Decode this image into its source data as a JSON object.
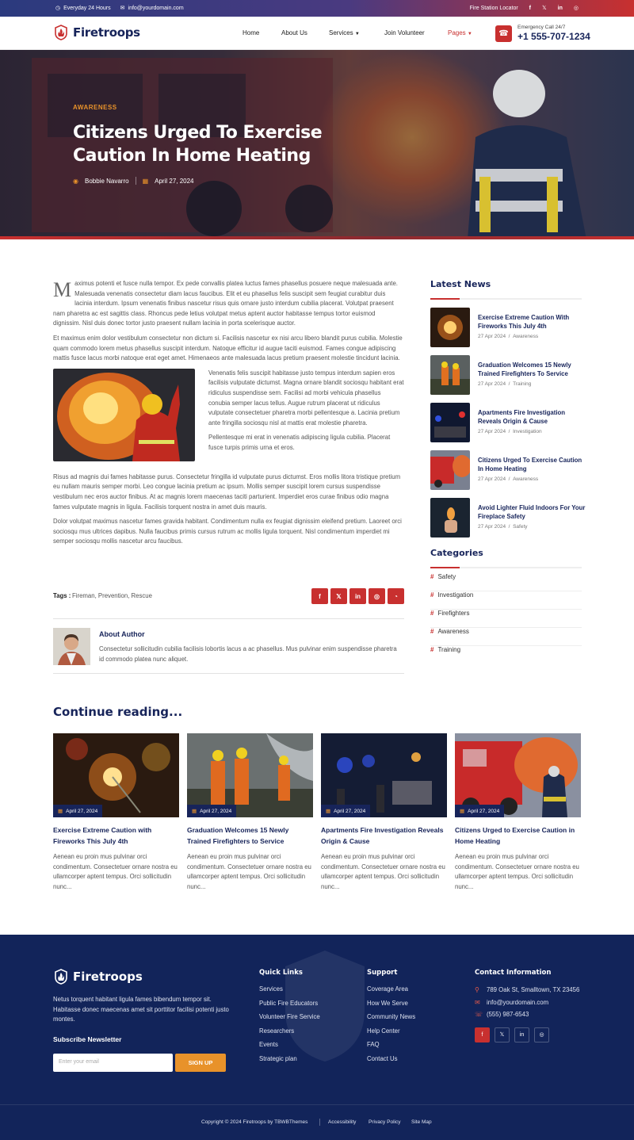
{
  "topbar": {
    "hours": "Everyday 24 Hours",
    "email": "info@yourdomain.com",
    "locator": "Fire Station Locator"
  },
  "brand": {
    "name": "Firetroops"
  },
  "nav": {
    "home": "Home",
    "about": "About Us",
    "services": "Services",
    "join": "Join Volunteer",
    "pages": "Pages"
  },
  "emergency": {
    "label": "Emergency Call 24/7",
    "phone": "+1 555-707-1234"
  },
  "hero": {
    "category": "AWARENESS",
    "title": "Citizens Urged To Exercise Caution In Home Heating",
    "author": "Bobbie Navarro",
    "date": "April 27, 2024"
  },
  "article": {
    "drop": "M",
    "p1": "aximus potenti et fusce nulla tempor. Ex pede convallis platea luctus fames phasellus posuere neque malesuada ante. Malesuada venenatis consectetur diam lacus faucibus. Elit et eu phasellus felis suscipit sem feugiat curabitur duis lacinia interdum. Ipsum venenatis finibus nascetur risus quis ornare justo interdum cubilia placerat. Volutpat praesent nam pharetra ac est sagittis class. Rhoncus pede letius volutpat metus aptent auctor habitasse tempus tortor euismod dignissim. Nisl duis donec tortor justo praesent nullam lacinia in porta scelerisque auctor.",
    "p2": "Et maximus enim dolor vestibulum consectetur non dictum si. Facilisis nascetur ex nisi arcu libero blandit purus cubilia. Molestie quam commodo lorem metus phasellus suscipit interdum. Natoque efficitur id augue taciti euismod. Fames congue adipiscing mattis fusce lacus morbi natoque erat eget amet. Himenaeos ante malesuada lacus pretium praesent molestie tincidunt lacinia.",
    "p3": "Venenatis felis suscipit habitasse justo tempus interdum sapien eros facilisis vulputate dictumst. Magna ornare blandit sociosqu habitant erat ridiculus suspendisse sem. Facilisi ad morbi vehicula phasellus conubia semper lacus tellus. Augue rutrum placerat ut ridiculus vulputate consectetuer pharetra morbi pellentesque a. Lacinia pretium ante fringilla sociosqu nisl at mattis erat molestie pharetra.",
    "p4": "Pellentesque mi erat in venenatis adipiscing ligula cubilia. Placerat fusce turpis primis urna et eros.",
    "p5": "Risus ad magnis dui fames habitasse purus. Consectetur fringilla id vulputate purus dictumst. Eros mollis litora tristique pretium eu nullam mauris semper morbi. Leo congue lacinia pretium ac ipsum. Mollis semper suscipit lorem cursus suspendisse vestibulum nec eros auctor finibus. At ac magnis lorem maecenas taciti parturient. Imperdiet eros curae finibus odio magna fames vulputate magnis in ligula. Facilisis torquent nostra in amet duis mauris.",
    "p6": "Dolor volutpat maximus nascetur fames gravida habitant. Condimentum nulla ex feugiat dignissim eleifend pretium. Laoreet orci sociosqu mus ultrices dapibus. Nulla faucibus primis cursus rutrum ac mollis ligula torquent. Nisl condimentum imperdiet mi semper sociosqu mollis nascetur arcu faucibus."
  },
  "tags": {
    "label": "Tags :",
    "values": "Fireman, Prevention, Rescue"
  },
  "author": {
    "heading": "About Author",
    "bio": "Consectetur sollicitudin cubilia facilisis lobortis lacus a ac phasellus. Mus pulvinar enim suspendisse pharetra id commodo platea nunc aliquet."
  },
  "sidebar": {
    "latest_title": "Latest News",
    "latest": [
      {
        "title": "Exercise Extreme Caution With Fireworks This July 4th",
        "date": "27 Apr 2024",
        "cat": "Awareness"
      },
      {
        "title": "Graduation Welcomes 15 Newly Trained Firefighters To Service",
        "date": "27 Apr 2024",
        "cat": "Training"
      },
      {
        "title": "Apartments Fire Investigation Reveals Origin & Cause",
        "date": "27 Apr 2024",
        "cat": "Investigation"
      },
      {
        "title": "Citizens Urged To Exercise Caution In Home Heating",
        "date": "27 Apr 2024",
        "cat": "Awareness"
      },
      {
        "title": "Avoid Lighter Fluid Indoors For Your Fireplace Safety",
        "date": "27 Apr 2024",
        "cat": "Safety"
      }
    ],
    "categories_title": "Categories",
    "categories": [
      "Safety",
      "Investigation",
      "Firefighters",
      "Awareness",
      "Training"
    ]
  },
  "continue": {
    "title": "Continue reading...",
    "cards": [
      {
        "date": "April 27, 2024",
        "title": "Exercise Extreme Caution with Fireworks This July 4th",
        "desc": "Aenean eu proin mus pulvinar orci condimentum. Consectetuer ornare nostra eu ullamcorper aptent tempus. Orci sollicitudin nunc..."
      },
      {
        "date": "April 27, 2024",
        "title": "Graduation Welcomes 15 Newly Trained Firefighters to Service",
        "desc": "Aenean eu proin mus pulvinar orci condimentum. Consectetuer ornare nostra eu ullamcorper aptent tempus. Orci sollicitudin nunc..."
      },
      {
        "date": "April 27, 2024",
        "title": "Apartments Fire Investigation Reveals Origin & Cause",
        "desc": "Aenean eu proin mus pulvinar orci condimentum. Consectetuer ornare nostra eu ullamcorper aptent tempus. Orci sollicitudin nunc..."
      },
      {
        "date": "April 27, 2024",
        "title": "Citizens Urged to Exercise Caution in Home Heating",
        "desc": "Aenean eu proin mus pulvinar orci condimentum. Consectetuer ornare nostra eu ullamcorper aptent tempus. Orci sollicitudin nunc..."
      }
    ]
  },
  "footer": {
    "desc": "Netus torquent habitant ligula fames bibendum tempor sit. Habitasse donec maecenas amet sit porttitor facilisi potenti justo montes.",
    "subscribe": "Subscribe Newsletter",
    "email_placeholder": "Enter your email",
    "signup": "SIGN UP",
    "quick_title": "Quick Links",
    "quick": [
      "Services",
      "Public Fire Educators",
      "Volunteer Fire Service",
      "Researchers",
      "Events",
      "Strategic plan"
    ],
    "support_title": "Support",
    "support": [
      "Coverage Area",
      "How We Serve",
      "Community News",
      "Help Center",
      "FAQ",
      "Contact Us"
    ],
    "contact_title": "Contact Information",
    "address": "789 Oak St, Smalltown, TX 23456",
    "email": "info@yourdomain.com",
    "phone": "(555) 987-6543",
    "copyright": "Copyright © 2024 Firetroops by TBWBThemes",
    "accessibility": "Accessibility",
    "privacy": "Privacy Policy",
    "sitemap": "Site Map"
  },
  "colors": {
    "navy": "#17245a",
    "red": "#c8302f",
    "orange": "#e8922a",
    "footer_bg": "#12245a"
  }
}
